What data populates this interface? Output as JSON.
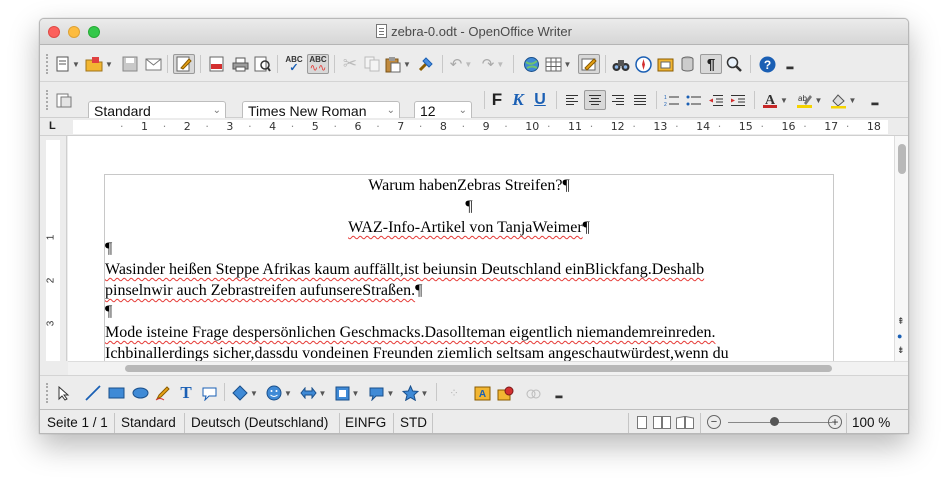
{
  "window": {
    "title": "zebra-0.odt - OpenOffice Writer"
  },
  "format_bar": {
    "paragraph_style": "Standard",
    "font_name": "Times New Roman",
    "font_size": "12",
    "bold_label": "F",
    "italic_label": "K",
    "underline_label": "U",
    "spellcheck_label": "ABC",
    "spellcheck_auto_label": "ABC"
  },
  "ruler": {
    "numbers": [
      "1",
      "2",
      "3",
      "4",
      "5",
      "6",
      "7",
      "8",
      "9",
      "10",
      "11",
      "12",
      "13",
      "14",
      "15",
      "16",
      "17",
      "18"
    ],
    "tab_label": "L",
    "vertical_numbers": [
      "1",
      "2",
      "3"
    ]
  },
  "document": {
    "title_line": "Warum habenZebras Streifen?",
    "subtitle_line": "WAZ-Info-Artikel von TanjaWeimer",
    "pilcrow": "¶",
    "para1_line1": "Wasinder heißen Steppe Afrikas kaum auffällt,ist beiunsin Deutschland einBlickfang.Deshalb",
    "para1_line2": "pinselnwir auch Zebrastreifen aufunsereStraßen.",
    "para2_line1": "Mode isteine Frage despersönlichen Geschmacks.Dasollteman eigentlich niemandemreinreden.",
    "para2_line2": "Ichbinallerdings sicher,dassdu vondeinen Freunden ziemlich seltsam angeschautwürdest,wenn du"
  },
  "statusbar": {
    "page": "Seite 1 / 1",
    "style": "Standard",
    "language": "Deutsch (Deutschland)",
    "insert_mode": "EINFG",
    "selection_mode": "STD",
    "zoom": "100 %",
    "zoom_minus": "−",
    "zoom_plus": "+"
  },
  "colors": {
    "accent": "#1a5fb4",
    "spell_error": "#e53935",
    "font_color": "#c62828",
    "highlight": "#f5d300"
  }
}
